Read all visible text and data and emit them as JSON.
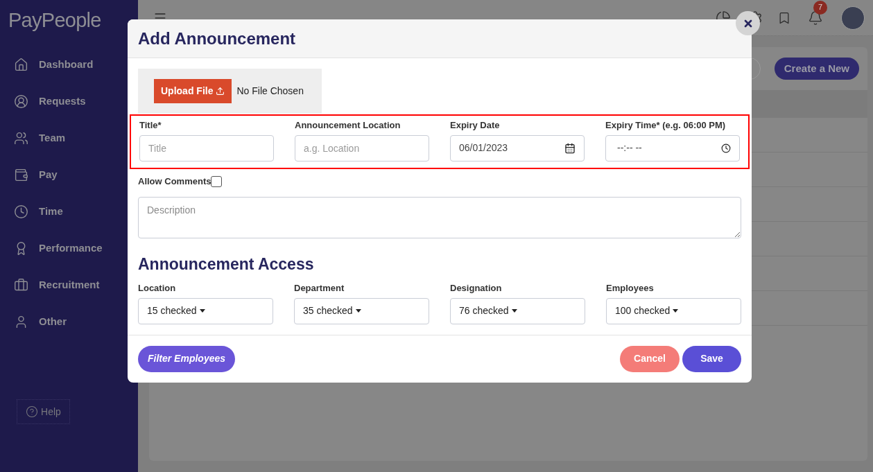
{
  "logo": "PayPeople",
  "sidebar": {
    "items": [
      {
        "label": "Dashboard"
      },
      {
        "label": "Requests"
      },
      {
        "label": "Team"
      },
      {
        "label": "Pay"
      },
      {
        "label": "Time"
      },
      {
        "label": "Performance"
      },
      {
        "label": "Recruitment"
      },
      {
        "label": "Other"
      }
    ],
    "help": "Help"
  },
  "header": {
    "notification_count": "7"
  },
  "page": {
    "create_button": "Create a New"
  },
  "modal": {
    "title": "Add Announcement",
    "upload": {
      "button": "Upload File",
      "status": "No File Chosen"
    },
    "fields": [
      {
        "kind": "text",
        "label": "Title*",
        "placeholder": "Title"
      },
      {
        "kind": "text",
        "label": "Announcement Location",
        "placeholder": "a.g. Location"
      },
      {
        "kind": "date",
        "label": "Expiry Date",
        "value": "06/01/2023"
      },
      {
        "kind": "time",
        "label": "Expiry Time* (e.g. 06:00 PM)",
        "value": "--:-- --"
      }
    ],
    "allow_comments": {
      "label": "Allow Comments",
      "checked": false
    },
    "description": {
      "placeholder": "Description"
    },
    "access": {
      "heading": "Announcement Access",
      "fields": [
        {
          "label": "Location",
          "value": "15 checked"
        },
        {
          "label": "Department",
          "value": "35 checked"
        },
        {
          "label": "Designation",
          "value": "76 checked"
        },
        {
          "label": "Employees",
          "value": "100 checked"
        }
      ]
    },
    "buttons": {
      "filter": "Filter Employees",
      "cancel": "Cancel",
      "save": "Save"
    }
  }
}
